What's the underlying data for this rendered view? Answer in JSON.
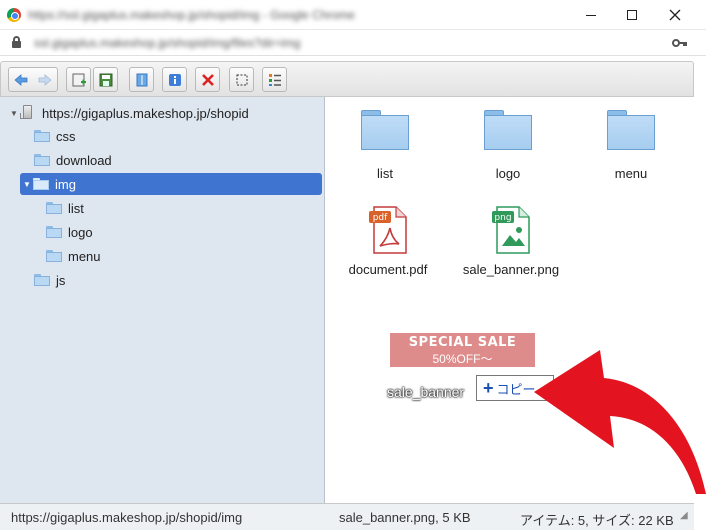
{
  "window": {
    "title": "https://ssl.gigaplus.makeshop.jp/shopid/img - Google Chrome",
    "url": "ssl.gigaplus.makeshop.jp/shopid/img/files?dir=img",
    "colors": {
      "selection": "#3f74d0",
      "sidebar": "#dee6ef",
      "arrow": "#e3141f"
    }
  },
  "toolbar": {
    "buttons": [
      {
        "name": "back-icon"
      },
      {
        "name": "forward-icon"
      },
      {
        "name": "upload-icon"
      },
      {
        "name": "save-icon"
      },
      {
        "name": "bookmark-icon"
      },
      {
        "name": "info-icon"
      },
      {
        "name": "delete-icon"
      },
      {
        "name": "select-icon"
      },
      {
        "name": "list-view-icon"
      }
    ]
  },
  "tree": {
    "root": "https://gigaplus.makeshop.jp/shopid",
    "items": [
      {
        "label": "css"
      },
      {
        "label": "download"
      },
      {
        "label": "img"
      },
      {
        "label": "list"
      },
      {
        "label": "logo"
      },
      {
        "label": "menu"
      },
      {
        "label": "js"
      }
    ]
  },
  "main": {
    "folders": [
      {
        "label": "list"
      },
      {
        "label": "logo"
      },
      {
        "label": "menu"
      }
    ],
    "files": [
      {
        "label": "document.pdf",
        "badge": "pdf"
      },
      {
        "label": "sale_banner.png",
        "badge": "png"
      }
    ],
    "drag": {
      "banner_line1": "SPECIAL SALE",
      "banner_line2": "50%OFF～",
      "label": "sale_banner",
      "copy_tip": "コピー"
    }
  },
  "status": {
    "path": "https://gigaplus.makeshop.jp/shopid/img",
    "selection": "sale_banner.png, 5 KB",
    "summary": "アイテム: 5, サイズ: 22 KB"
  }
}
